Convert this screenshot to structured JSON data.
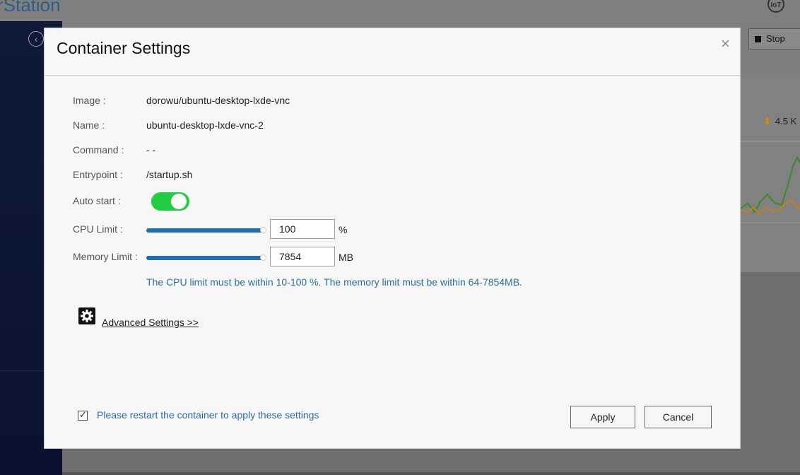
{
  "background": {
    "app_title": "rStation",
    "iot_label": "IoT",
    "stop_label": "Stop",
    "rate_label": "4.5 K"
  },
  "dialog": {
    "title": "Container Settings",
    "close_glyph": "×",
    "fields": {
      "image_label": "Image :",
      "image_value": "dorowu/ubuntu-desktop-lxde-vnc",
      "name_label": "Name :",
      "name_value": "ubuntu-desktop-lxde-vnc-2",
      "command_label": "Command :",
      "command_value": "- -",
      "entrypoint_label": "Entrypoint :",
      "entrypoint_value": "/startup.sh",
      "autostart_label": "Auto start :",
      "autostart_on": true,
      "cpu_label": "CPU Limit :",
      "cpu_value": "100",
      "cpu_unit": "%",
      "cpu_slider_fraction": 1.0,
      "memory_label": "Memory Limit :",
      "memory_value": "7854",
      "memory_unit": "MB",
      "memory_slider_fraction": 1.0
    },
    "hint": "The CPU limit must be within 10-100 %. The memory limit must be within 64-7854MB.",
    "advanced_link": "Advanced Settings >>",
    "restart_label": "Please restart the container to apply these settings",
    "restart_checked": true,
    "apply_label": "Apply",
    "cancel_label": "Cancel"
  },
  "colors": {
    "accent_blue": "#1a6fb8",
    "link_blue": "#2b6ca8",
    "toggle_on": "#22cc44",
    "sidebar": "#0f1a3a"
  }
}
